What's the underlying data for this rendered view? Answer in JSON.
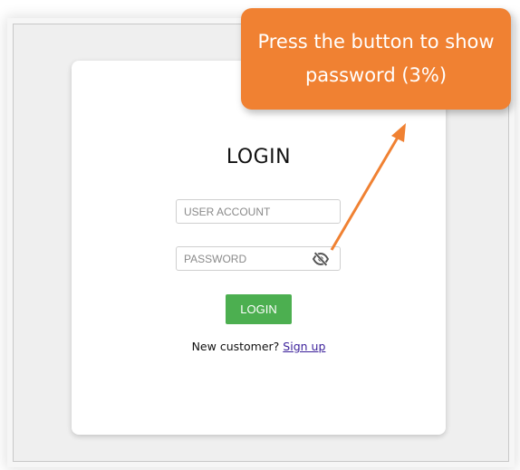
{
  "login": {
    "title": "LOGIN",
    "user_placeholder": "USER ACCOUNT",
    "password_placeholder": "PASSWORD",
    "password_toggle_icon": "eye-slash-icon",
    "button_label": "LOGIN",
    "signup_prompt": "New customer? ",
    "signup_link": "Sign up"
  },
  "annotation": {
    "text": "Press the button to show password (3%)"
  },
  "colors": {
    "login_button": "#4caf50",
    "annotation": "#f08132",
    "signup_link": "#3a1f9a"
  }
}
